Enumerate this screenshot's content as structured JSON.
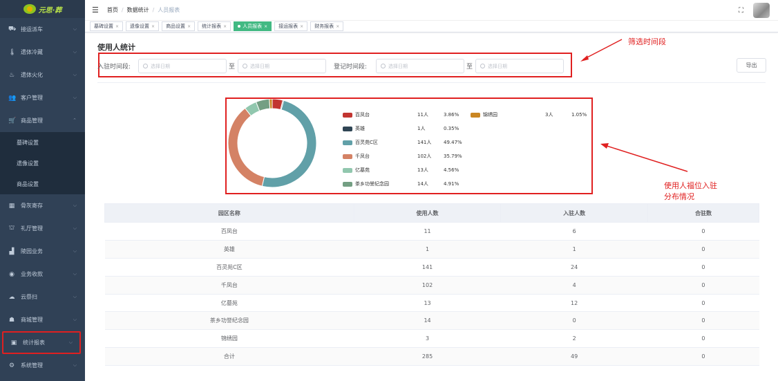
{
  "app": {
    "logo_text": "元思·葬"
  },
  "sidebar": {
    "items": [
      {
        "label": "接运派车",
        "icon": "truck-icon"
      },
      {
        "label": "遗体冷藏",
        "icon": "thermometer-icon"
      },
      {
        "label": "遗体火化",
        "icon": "flame-icon"
      },
      {
        "label": "客户管理",
        "icon": "users-icon"
      },
      {
        "label": "商品管理",
        "icon": "cart-icon"
      }
    ],
    "subitems": [
      {
        "label": "墓碑设置"
      },
      {
        "label": "遗像设置"
      },
      {
        "label": "商品设置"
      }
    ],
    "items2": [
      {
        "label": "骨灰寄存",
        "icon": "grid-icon"
      },
      {
        "label": "礼厅管理",
        "icon": "hall-icon"
      },
      {
        "label": "陵园业务",
        "icon": "chart-icon"
      },
      {
        "label": "业务收款",
        "icon": "money-icon"
      },
      {
        "label": "云祭扫",
        "icon": "cloud-icon"
      },
      {
        "label": "商城管理",
        "icon": "shop-icon"
      },
      {
        "label": "统计报表",
        "icon": "report-icon"
      },
      {
        "label": "系统管理",
        "icon": "gear-icon"
      }
    ]
  },
  "header": {
    "breadcrumb": [
      "首页",
      "数据统计",
      "人员报表"
    ]
  },
  "tabs": [
    {
      "label": "墓碑设置",
      "active": false
    },
    {
      "label": "遗像设置",
      "active": false
    },
    {
      "label": "商品设置",
      "active": false
    },
    {
      "label": "统计报表",
      "active": false
    },
    {
      "label": "人员报表",
      "active": true
    },
    {
      "label": "接运报表",
      "active": false
    },
    {
      "label": "财务报表",
      "active": false
    }
  ],
  "page": {
    "title": "使用人统计",
    "filter": {
      "label1": "入驻时间段:",
      "label2": "登记时间段:",
      "to": "至",
      "placeholder": "选择日期"
    },
    "export_label": "导出"
  },
  "annotations": {
    "filter_note": "筛选时间段",
    "chart_note_1": "使用人福位入驻",
    "chart_note_2": "分布情况"
  },
  "chart_data": {
    "type": "pie",
    "donut": true,
    "legend_position": "right",
    "slices": [
      {
        "name": "百凤台",
        "count": "11人",
        "percent": "3.86%",
        "value": 3.86,
        "color": "#c23531"
      },
      {
        "name": "英雄",
        "count": "1人",
        "percent": "0.35%",
        "value": 0.35,
        "color": "#2f4554"
      },
      {
        "name": "百灵苑C区",
        "count": "141人",
        "percent": "49.47%",
        "value": 49.47,
        "color": "#61a0a8"
      },
      {
        "name": "千凤台",
        "count": "102人",
        "percent": "35.79%",
        "value": 35.79,
        "color": "#d48265"
      },
      {
        "name": "亿墓苑",
        "count": "13人",
        "percent": "4.56%",
        "value": 4.56,
        "color": "#91c7ae"
      },
      {
        "name": "茶乡功誉纪念园",
        "count": "14人",
        "percent": "4.91%",
        "value": 4.91,
        "color": "#749f83"
      },
      {
        "name": "锦绣园",
        "count": "3人",
        "percent": "1.05%",
        "value": 1.05,
        "color": "#ca8622"
      }
    ]
  },
  "table": {
    "headers": [
      "园区名称",
      "使用人数",
      "入驻人数",
      "合驻数"
    ],
    "rows": [
      [
        "百凤台",
        "11",
        "6",
        "0"
      ],
      [
        "英雄",
        "1",
        "1",
        "0"
      ],
      [
        "百灵苑C区",
        "141",
        "24",
        "0"
      ],
      [
        "千凤台",
        "102",
        "4",
        "0"
      ],
      [
        "亿墓苑",
        "13",
        "12",
        "0"
      ],
      [
        "茶乡功誉纪念园",
        "14",
        "0",
        "0"
      ],
      [
        "锦绣园",
        "3",
        "2",
        "0"
      ],
      [
        "合计",
        "285",
        "49",
        "0"
      ]
    ]
  }
}
